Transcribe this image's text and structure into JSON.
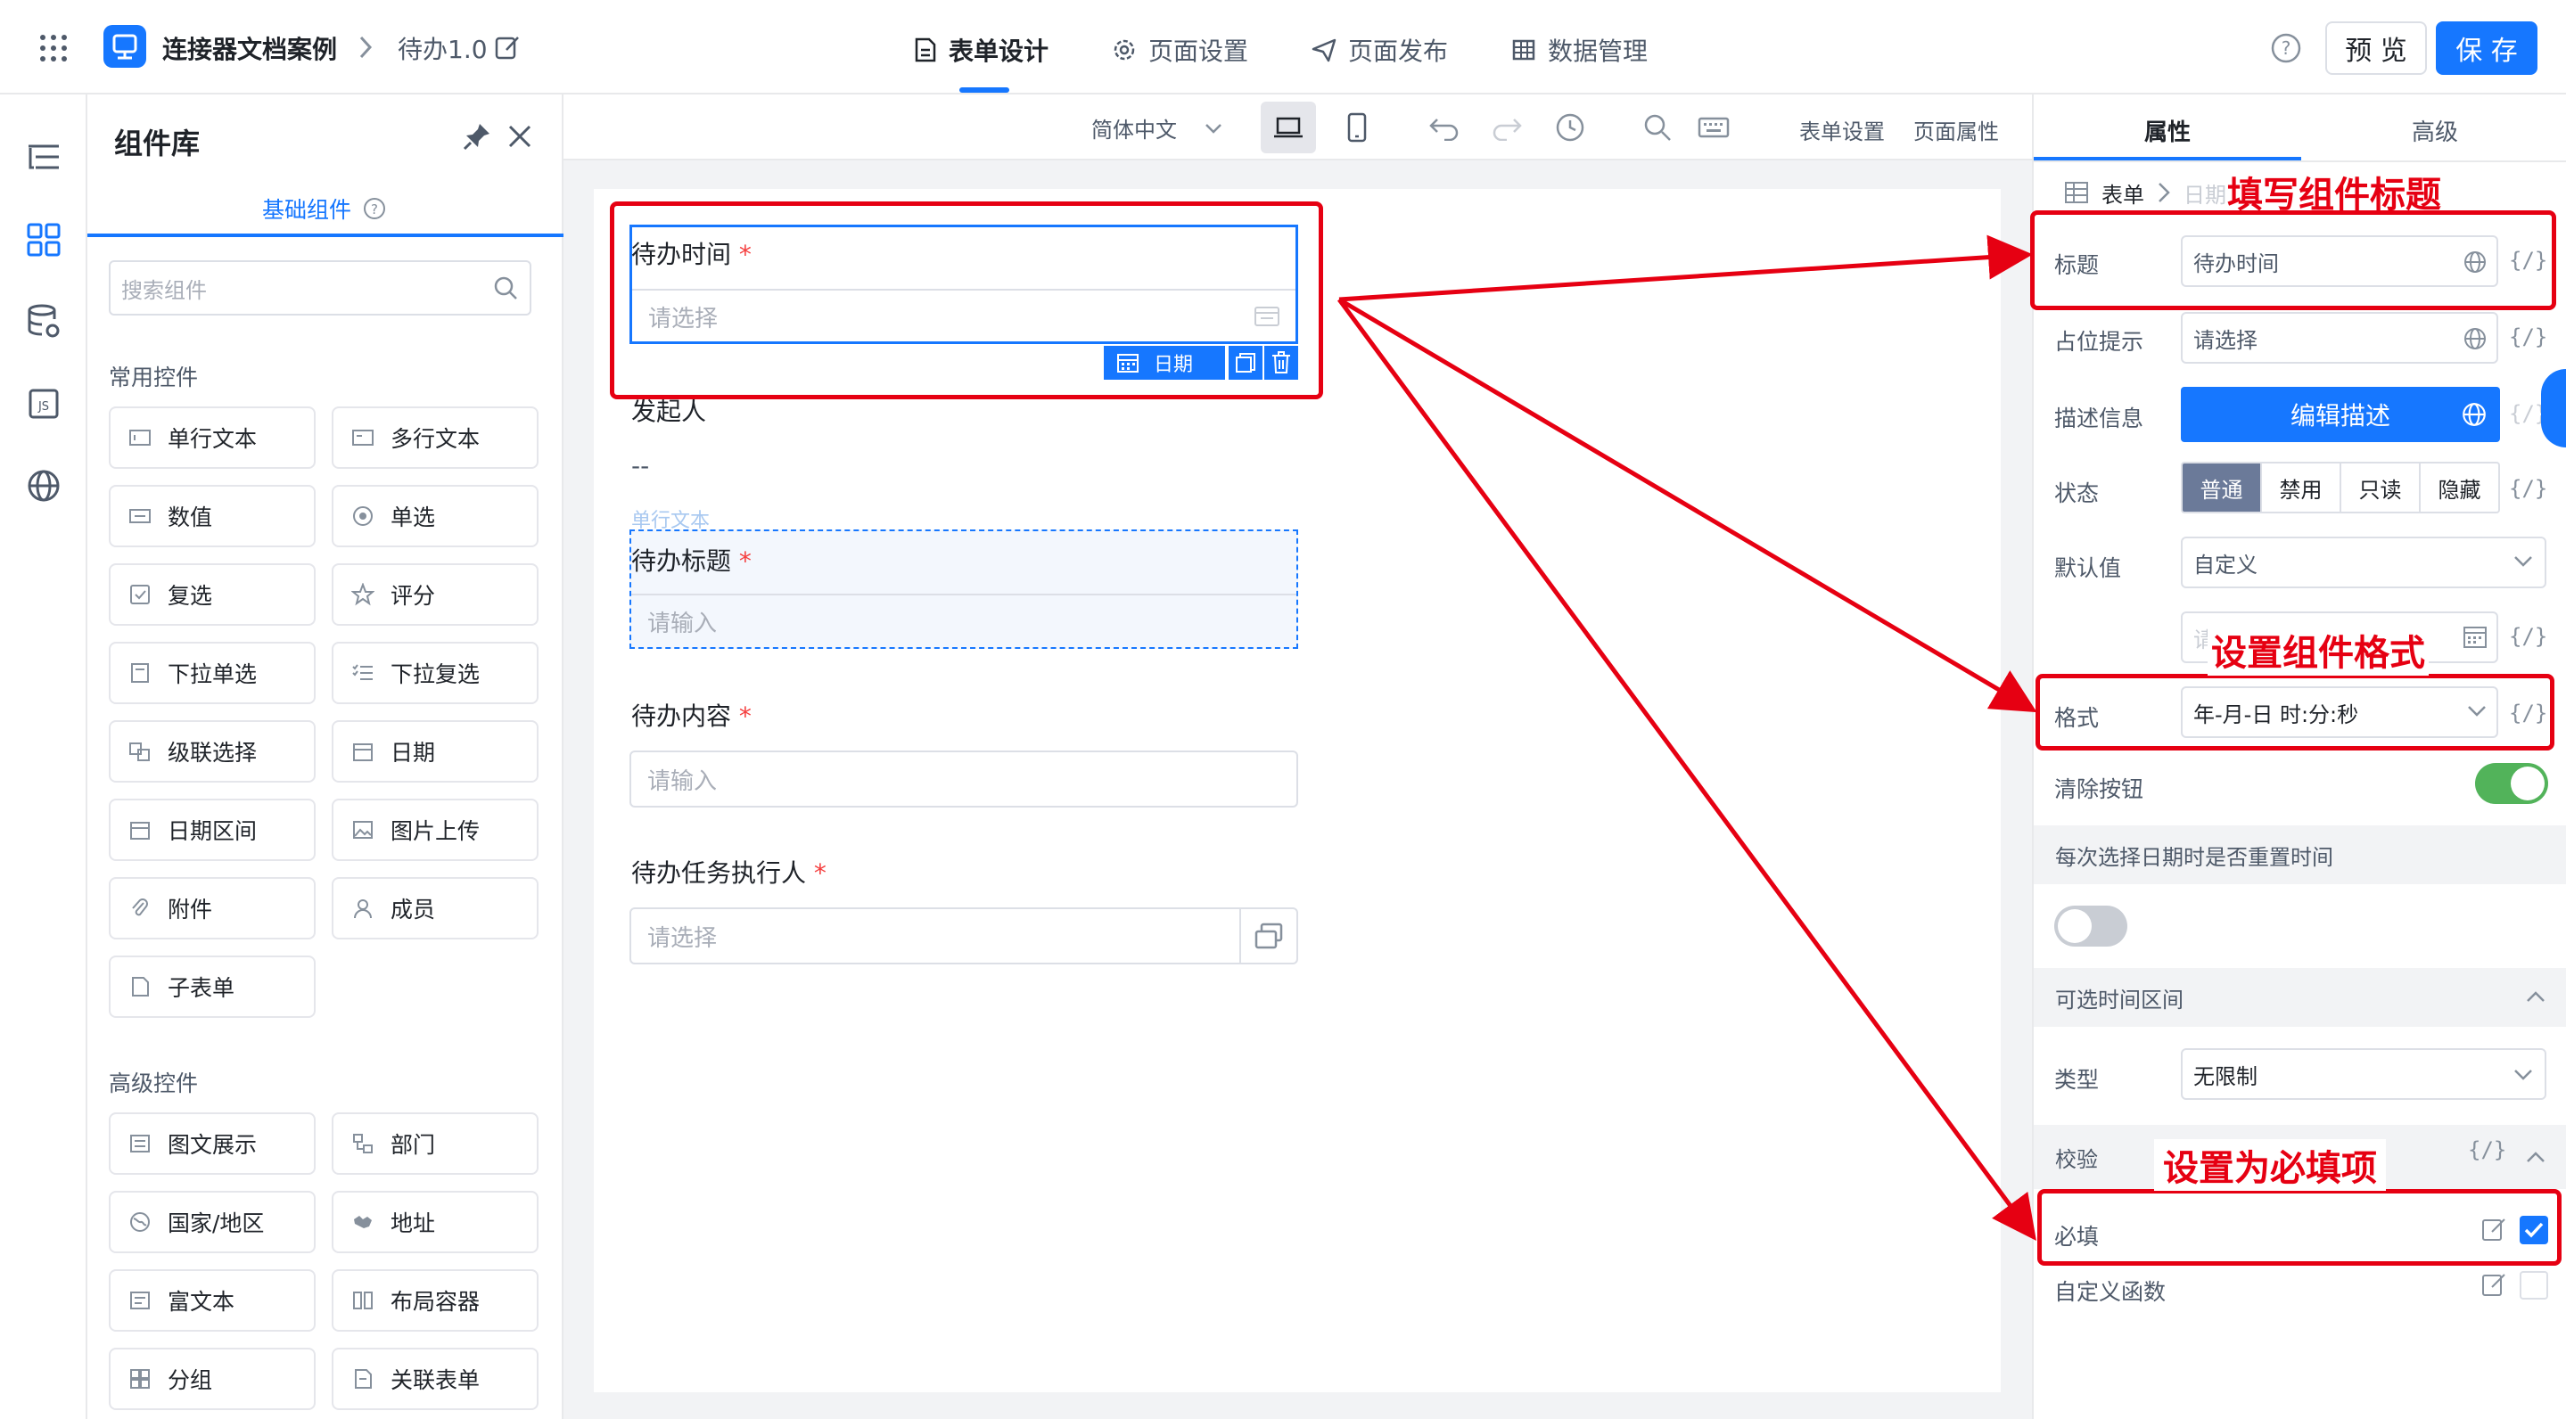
{
  "header": {
    "app_name": "连接器文档案例",
    "page_name": "待办1.0",
    "tabs": [
      {
        "label": "表单设计"
      },
      {
        "label": "页面设置"
      },
      {
        "label": "页面发布"
      },
      {
        "label": "数据管理"
      }
    ],
    "preview_label": "预 览",
    "save_label": "保 存",
    "accent_color": "#1677ff"
  },
  "library": {
    "title": "组件库",
    "tab_label": "基础组件",
    "search_placeholder": "搜索组件",
    "common_title": "常用控件",
    "common": [
      "单行文本",
      "多行文本",
      "数值",
      "单选",
      "复选",
      "评分",
      "下拉单选",
      "下拉复选",
      "级联选择",
      "日期",
      "日期区间",
      "图片上传",
      "附件",
      "成员",
      "子表单"
    ],
    "advanced_title": "高级控件",
    "advanced": [
      "图文展示",
      "部门",
      "国家/地区",
      "地址",
      "富文本",
      "布局容器",
      "分组",
      "关联表单"
    ]
  },
  "toolbar": {
    "language": "简体中文",
    "form_settings": "表单设置",
    "page_props": "页面属性"
  },
  "form": {
    "f1_label": "待办时间",
    "f1_placeholder": "请选择",
    "f1_badge": "日期",
    "f2_label": "发起人",
    "f2_value": "--",
    "f3_hint": "单行文本",
    "f3_label": "待办标题",
    "f3_placeholder": "请输入",
    "f4_label": "待办内容",
    "f4_placeholder": "请输入",
    "f5_label": "待办任务执行人",
    "f5_placeholder": "请选择",
    "required_mark": "*"
  },
  "props": {
    "tab_attr": "属性",
    "tab_adv": "高级",
    "crumb_1": "表单",
    "crumb_2": "日期",
    "title_label": "标题",
    "title_value": "待办时间",
    "placeholder_label": "占位提示",
    "placeholder_value": "请选择",
    "desc_label": "描述信息",
    "desc_button": "编辑描述",
    "state_label": "状态",
    "state_options": [
      "普通",
      "禁用",
      "只读",
      "隐藏"
    ],
    "default_label": "默认值",
    "default_value": "自定义",
    "default_date_placeholder": "请选择",
    "format_label": "格式",
    "format_value": "年-月-日 时:分:秒",
    "clear_label": "清除按钮",
    "reset_title": "每次选择日期时是否重置时间",
    "range_title": "可选时间区间",
    "type_label": "类型",
    "type_value": "无限制",
    "validate_title": "校验",
    "required_label": "必填",
    "custom_label": "自定义函数",
    "fx": "{/}"
  },
  "annotations": {
    "a1": "填写组件标题",
    "a2": "设置组件格式",
    "a3": "设置为必填项",
    "color": "#e60012"
  }
}
